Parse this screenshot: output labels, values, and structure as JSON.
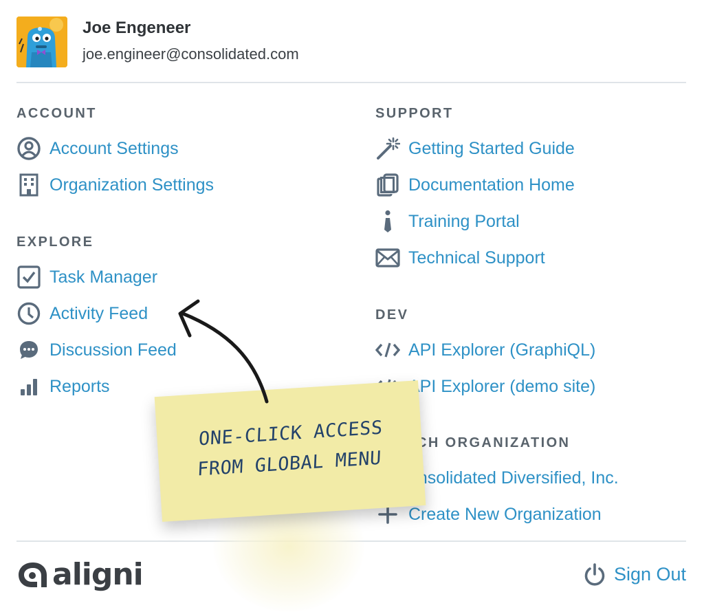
{
  "user": {
    "name": "Joe Engeneer",
    "email": "joe.engineer@consolidated.com"
  },
  "sections": {
    "account": {
      "title": "ACCOUNT",
      "items": [
        {
          "label": "Account Settings",
          "icon": "user-circle-icon"
        },
        {
          "label": "Organization Settings",
          "icon": "building-icon"
        }
      ]
    },
    "explore": {
      "title": "EXPLORE",
      "items": [
        {
          "label": "Task Manager",
          "icon": "checkbox-icon"
        },
        {
          "label": "Activity Feed",
          "icon": "clock-icon"
        },
        {
          "label": "Discussion Feed",
          "icon": "chat-bubble-icon"
        },
        {
          "label": "Reports",
          "icon": "bar-chart-icon"
        }
      ]
    },
    "support": {
      "title": "SUPPORT",
      "items": [
        {
          "label": "Getting Started Guide",
          "icon": "magic-wand-icon"
        },
        {
          "label": "Documentation Home",
          "icon": "documents-icon"
        },
        {
          "label": "Training Portal",
          "icon": "info-icon"
        },
        {
          "label": "Technical Support",
          "icon": "envelope-icon"
        }
      ]
    },
    "dev": {
      "title": "DEV",
      "items": [
        {
          "label": "API Explorer (GraphiQL)",
          "icon": "code-icon"
        },
        {
          "label": "API Explorer (demo site)",
          "icon": "code-icon"
        }
      ]
    },
    "switch_org": {
      "title": "CH ORGANIZATION",
      "items": [
        {
          "label": "onsolidated Diversified, Inc.",
          "icon": "building-icon"
        },
        {
          "label": "Create New Organization",
          "icon": "plus-icon"
        }
      ]
    }
  },
  "footer": {
    "logo_text": "aligni",
    "sign_out_label": "Sign Out"
  },
  "annotation": {
    "line1": "ONE-CLICK ACCESS",
    "line2": "FROM GLOBAL MENU"
  },
  "colors": {
    "link": "#2e91c6",
    "icon": "#5a6b7c",
    "section_title": "#59636c",
    "sticky_note": "#f2eba7",
    "annotation_text": "#23426a"
  }
}
